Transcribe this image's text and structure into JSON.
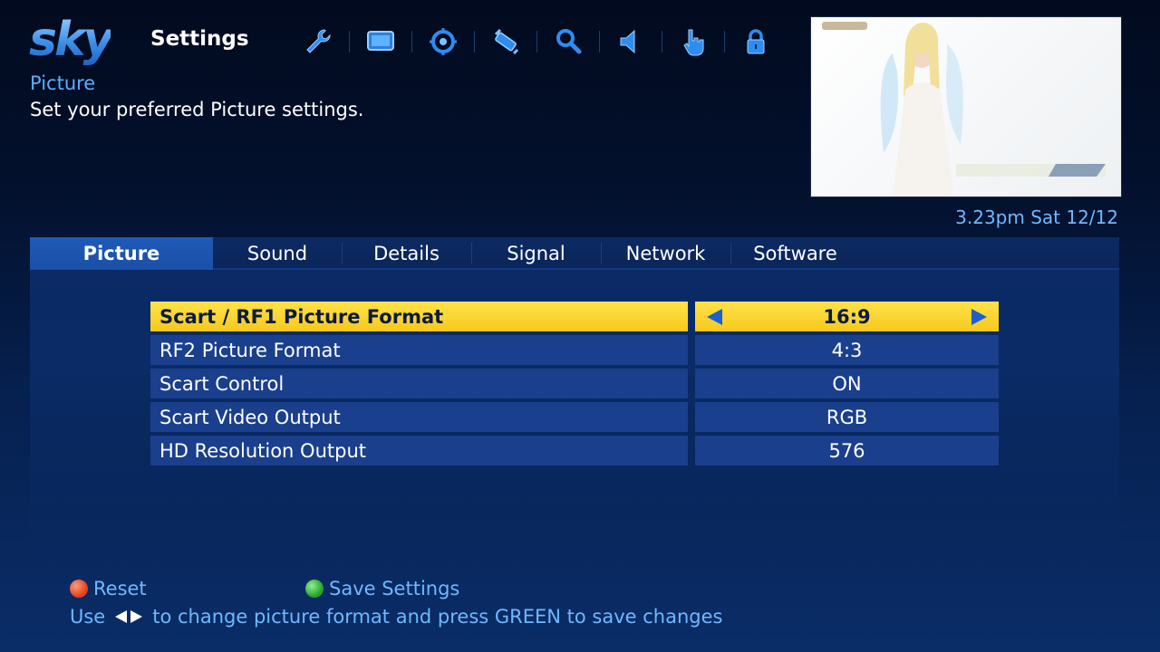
{
  "brand": {
    "logo_text": "sky"
  },
  "header": {
    "title": "Settings",
    "icons": [
      {
        "name": "wrench-icon"
      },
      {
        "name": "tv-screen-icon"
      },
      {
        "name": "target-icon"
      },
      {
        "name": "satellite-dish-icon"
      },
      {
        "name": "search-icon"
      },
      {
        "name": "speaker-icon"
      },
      {
        "name": "hand-pointer-icon"
      },
      {
        "name": "lock-icon"
      }
    ]
  },
  "section": {
    "title": "Picture",
    "description": "Set your preferred Picture settings."
  },
  "status": {
    "clock": "3.23pm Sat 12/12"
  },
  "tabs": [
    {
      "label": "Picture",
      "active": true
    },
    {
      "label": "Sound",
      "active": false
    },
    {
      "label": "Details",
      "active": false
    },
    {
      "label": "Signal",
      "active": false
    },
    {
      "label": "Network",
      "active": false
    },
    {
      "label": "Software",
      "active": false
    }
  ],
  "settings": [
    {
      "label": "Scart / RF1 Picture Format",
      "value": "16:9",
      "selected": true
    },
    {
      "label": "RF2 Picture Format",
      "value": "4:3",
      "selected": false
    },
    {
      "label": "Scart Control",
      "value": "ON",
      "selected": false
    },
    {
      "label": "Scart Video Output",
      "value": "RGB",
      "selected": false
    },
    {
      "label": "HD Resolution Output",
      "value": "576",
      "selected": false
    }
  ],
  "footer": {
    "reset_label": "Reset",
    "save_label": "Save Settings",
    "hint_prefix": "Use",
    "hint_suffix": "to change picture format and press GREEN to save changes"
  },
  "colors": {
    "accent_blue": "#5aaeff",
    "highlight_yellow": "#f7c81c",
    "row_blue": "#1a3f8c",
    "tab_active": "#1e5ab8",
    "red_button": "#e0401c",
    "green_button": "#26a02a"
  }
}
